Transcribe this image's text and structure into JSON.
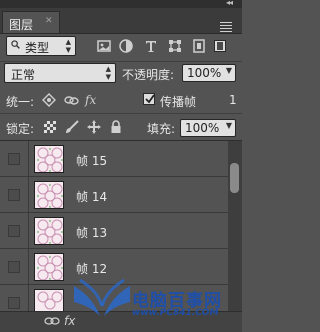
{
  "panel": {
    "tab_label": "图层",
    "tab_close": "✕",
    "collapse_glyph": "◂◂"
  },
  "filter": {
    "kind_label": "类型",
    "icons": [
      "image-filter-icon",
      "adjustment-filter-icon",
      "text-filter-icon",
      "shape-filter-icon",
      "smart-object-filter-icon"
    ]
  },
  "blend": {
    "mode": "正常",
    "opacity_label": "不透明度:",
    "opacity_value": "100%"
  },
  "unify": {
    "label": "统一:",
    "icons": [
      "unify-position-icon",
      "unify-visibility-icon",
      "unify-style-icon"
    ],
    "propagate_checked": true,
    "propagate_label": "传播帧",
    "frame_number": "1"
  },
  "lock": {
    "label": "锁定:",
    "icons": [
      "lock-transparent-icon",
      "lock-image-icon",
      "lock-position-icon",
      "lock-all-icon"
    ],
    "fill_label": "填充:",
    "fill_value": "100%"
  },
  "layers": [
    {
      "name": "帧 15",
      "visible": false
    },
    {
      "name": "帧 14",
      "visible": false
    },
    {
      "name": "帧 13",
      "visible": false
    },
    {
      "name": "帧 12",
      "visible": false
    }
  ],
  "footer": {
    "fx_label": "fx"
  },
  "watermark": {
    "title": "电脑百事网",
    "url": "www.PC841.COM"
  },
  "colors": {
    "panel_bg": "#535353",
    "field_bg": "#e1e1e1",
    "header_bg": "#3b3b3b",
    "watermark": "#1f4fa8"
  }
}
